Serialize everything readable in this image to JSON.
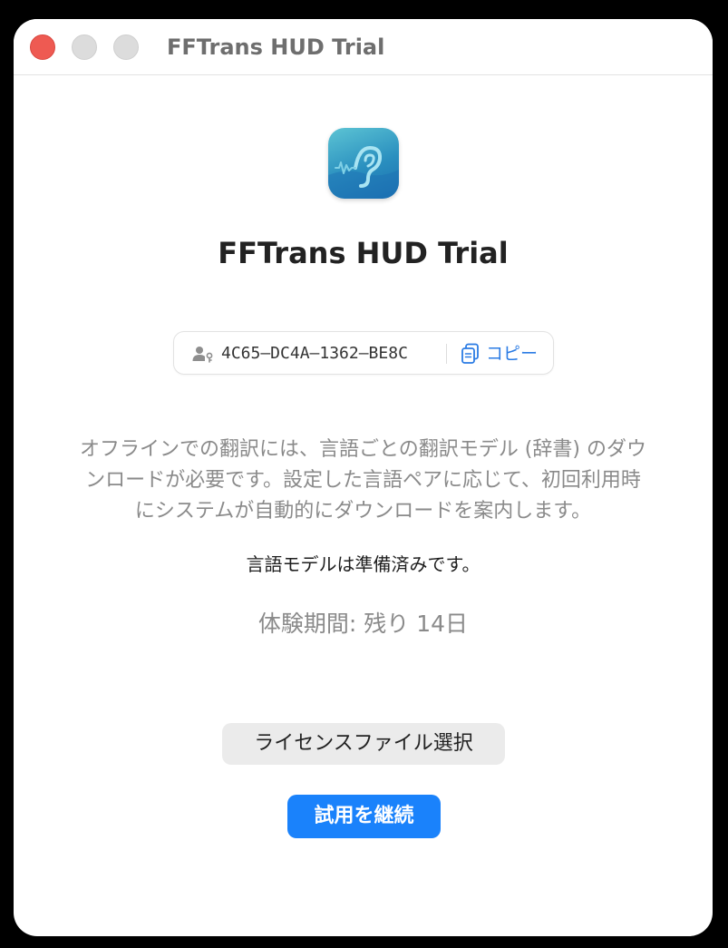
{
  "window": {
    "title": "FFTrans HUD Trial"
  },
  "app": {
    "name": "FFTrans HUD Trial",
    "icon": "ear-waveform-icon"
  },
  "device": {
    "id": "4C65–DC4A–1362–BE8C",
    "user_icon": "person-key-icon",
    "copy_icon": "documents-copy-icon",
    "copy_label": "コピー"
  },
  "description": {
    "lines": [
      "オフラインでの翻訳には、言語ごとの翻訳モデル (辞書) のダウ",
      "ンロードが必要です。設定した言語ペアに応じて、初回利用時",
      "にシステムが自動的にダウンロードを案内します。"
    ]
  },
  "status": {
    "model_ready": "言語モデルは準備済みです。",
    "trial_remaining": "体験期間: 残り 14日"
  },
  "buttons": {
    "select_license": "ライセンスファイル選択",
    "continue_trial": "試用を継続"
  },
  "colors": {
    "accent": "#1a82fb",
    "link": "#2a7be4",
    "close": "#ee5a52"
  }
}
